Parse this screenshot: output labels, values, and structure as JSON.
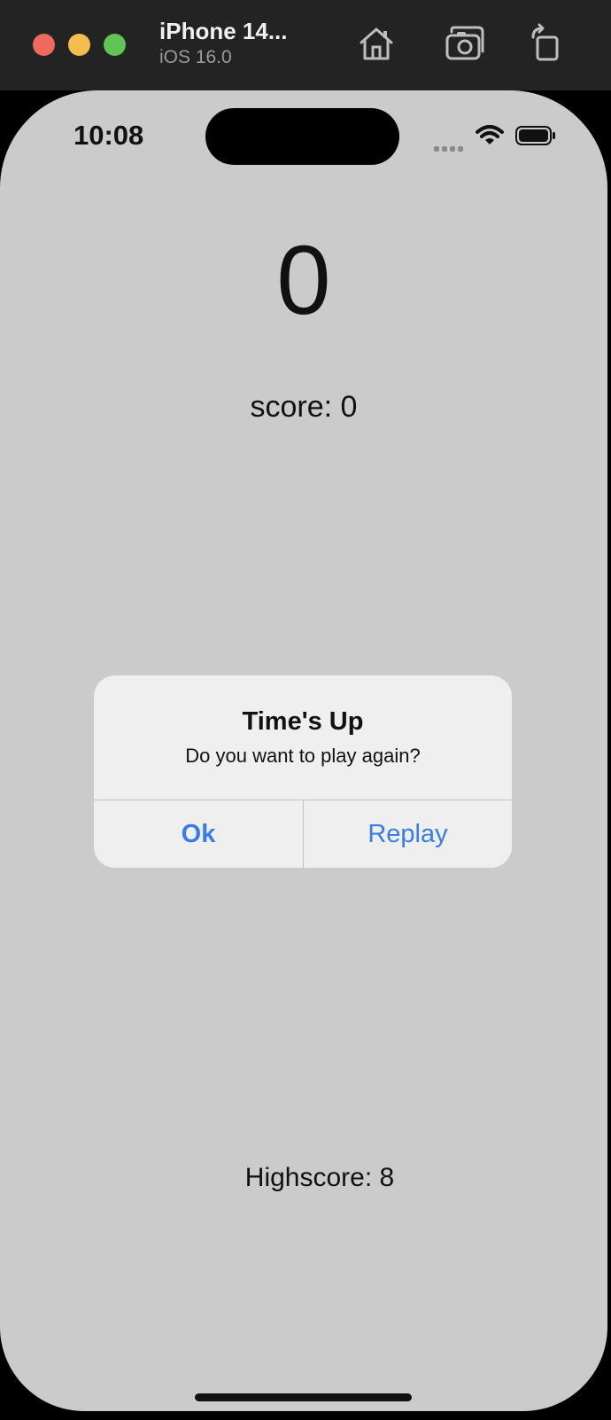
{
  "window": {
    "device_name": "iPhone 14...",
    "os_version": "iOS 16.0",
    "toolbar_icons": [
      "home-icon",
      "screenshot-icon",
      "rotate-icon"
    ]
  },
  "status_bar": {
    "time": "10:08",
    "icons": [
      "cellular-signal-icon",
      "wifi-icon",
      "battery-icon"
    ]
  },
  "game": {
    "countdown": "0",
    "score_label": "score: 0",
    "highscore_label": "Highscore: 8"
  },
  "alert": {
    "title": "Time's Up",
    "message": "Do you want to play again?",
    "buttons": {
      "ok": "Ok",
      "replay": "Replay"
    },
    "button_color": "#3a7ce6"
  },
  "colors": {
    "screen_background": "#cbcbcb",
    "alert_background": "#efefef",
    "traffic_red": "#ee6a5e",
    "traffic_yellow": "#f5bd4f",
    "traffic_green": "#61c454"
  }
}
